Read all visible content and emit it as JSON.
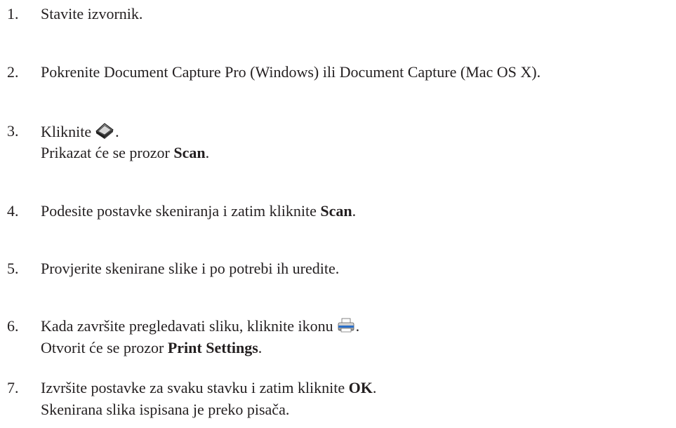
{
  "steps": [
    {
      "number": "1.",
      "text": "Stavite izvornik."
    },
    {
      "number": "2.",
      "text": "Pokrenite Document Capture Pro (Windows) ili Document Capture (Mac OS X)."
    },
    {
      "number": "3.",
      "text_before": "Kliknite",
      "icon": "scan-icon",
      "text_after": ".",
      "result_before": "Prikazat će se prozor ",
      "result_bold": "Scan",
      "result_after": "."
    },
    {
      "number": "4.",
      "text_before": "Podesite postavke skeniranja i zatim kliknite ",
      "bold": "Scan",
      "text_after": "."
    },
    {
      "number": "5.",
      "text": "Provjerite skenirane slike i po potrebi ih uredite."
    },
    {
      "number": "6.",
      "text_before": "Kada završite pregledavati sliku, kliknite ikonu",
      "icon": "print-icon",
      "text_after": ".",
      "result_before": "Otvorit će se prozor ",
      "result_bold": "Print Settings",
      "result_after": "."
    },
    {
      "number": "7.",
      "text_before": "Izvršite postavke za svaku stavku i zatim kliknite ",
      "bold": "OK",
      "text_after": ".",
      "result": "Skenirana slika ispisana je preko pisača."
    }
  ]
}
